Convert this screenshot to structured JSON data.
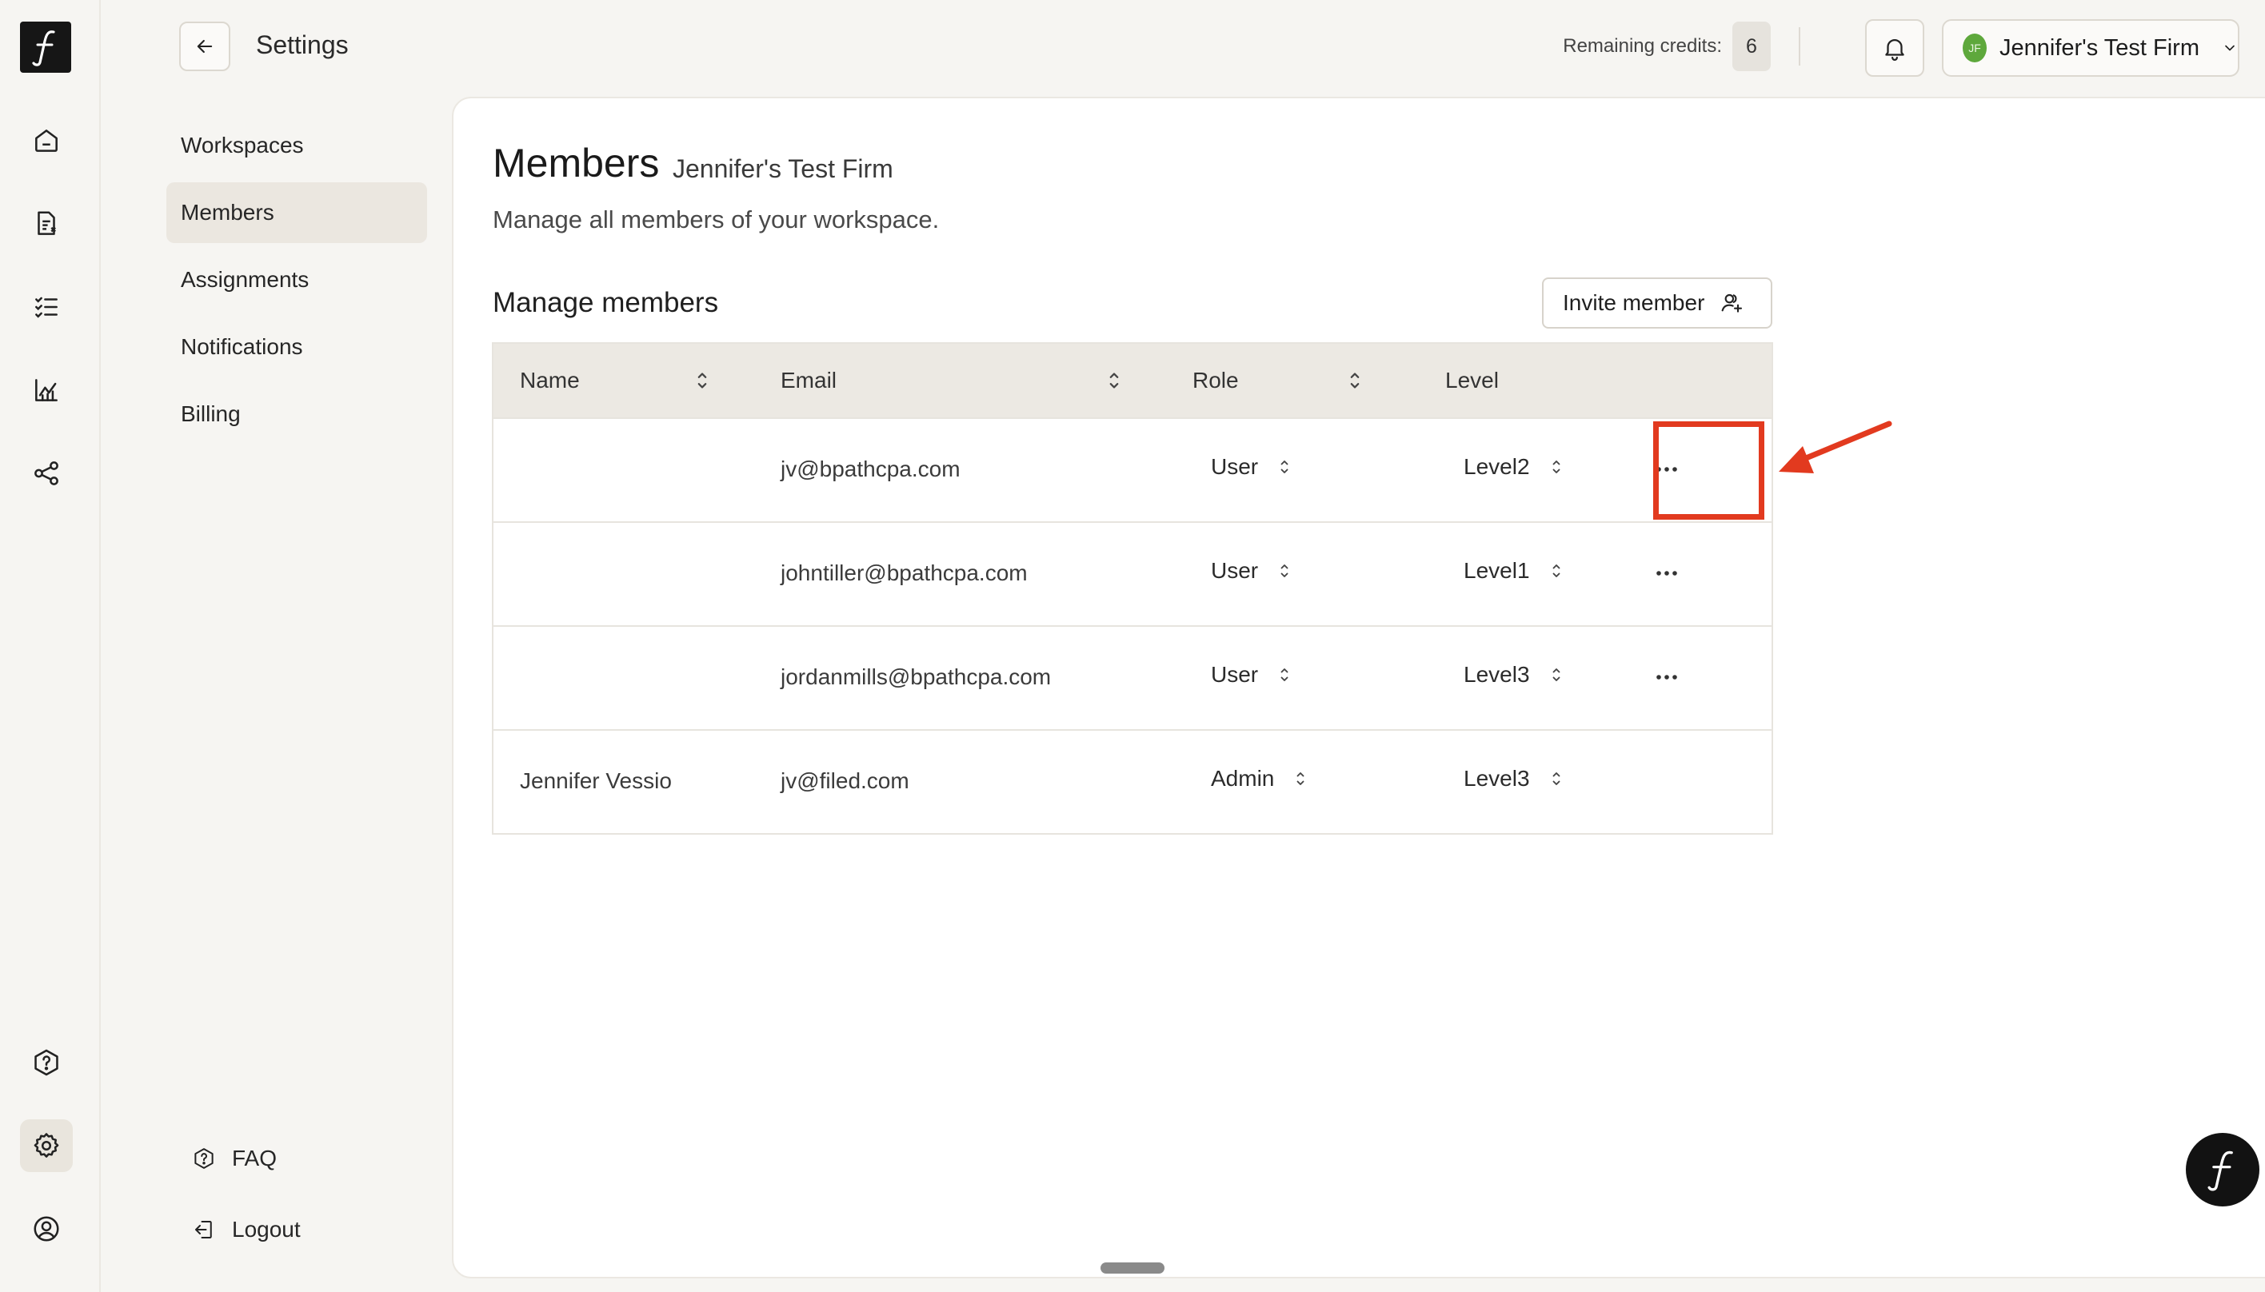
{
  "header": {
    "settings_title": "Settings",
    "credits_label": "Remaining credits:",
    "credits_value": "6",
    "workspace_initials": "JF",
    "workspace_name": "Jennifer's Test Firm"
  },
  "rail": {
    "items": [
      {
        "name": "home-icon"
      },
      {
        "name": "document-icon"
      },
      {
        "name": "checklist-icon"
      },
      {
        "name": "analytics-icon"
      },
      {
        "name": "share-icon"
      },
      {
        "name": "help-icon"
      },
      {
        "name": "gear-icon",
        "active": true
      },
      {
        "name": "user-circle-icon"
      }
    ]
  },
  "settings_nav": {
    "items": [
      {
        "label": "Workspaces"
      },
      {
        "label": "Members",
        "active": true
      },
      {
        "label": "Assignments"
      },
      {
        "label": "Notifications"
      },
      {
        "label": "Billing"
      }
    ],
    "faq_label": "FAQ",
    "logout_label": "Logout"
  },
  "page": {
    "title": "Members",
    "subtitle": "Jennifer's Test Firm",
    "description": "Manage all members of your workspace.",
    "section_title": "Manage members",
    "invite_label": "Invite member"
  },
  "table": {
    "columns": [
      "Name",
      "Email",
      "Role",
      "Level"
    ],
    "rows": [
      {
        "name": "",
        "email": "jv@bpathcpa.com",
        "role": "User",
        "level": "Level2",
        "has_menu": true
      },
      {
        "name": "",
        "email": "johntiller@bpathcpa.com",
        "role": "User",
        "level": "Level1",
        "has_menu": true
      },
      {
        "name": "",
        "email": "jordanmills@bpathcpa.com",
        "role": "User",
        "level": "Level3",
        "has_menu": true
      },
      {
        "name": "Jennifer Vessio",
        "email": "jv@filed.com",
        "role": "Admin",
        "level": "Level3",
        "has_menu": false
      }
    ]
  },
  "colors": {
    "accent_annotation": "#e23a1f",
    "avatar_green": "#5ea83c",
    "table_header_bg": "#ece9e3"
  }
}
